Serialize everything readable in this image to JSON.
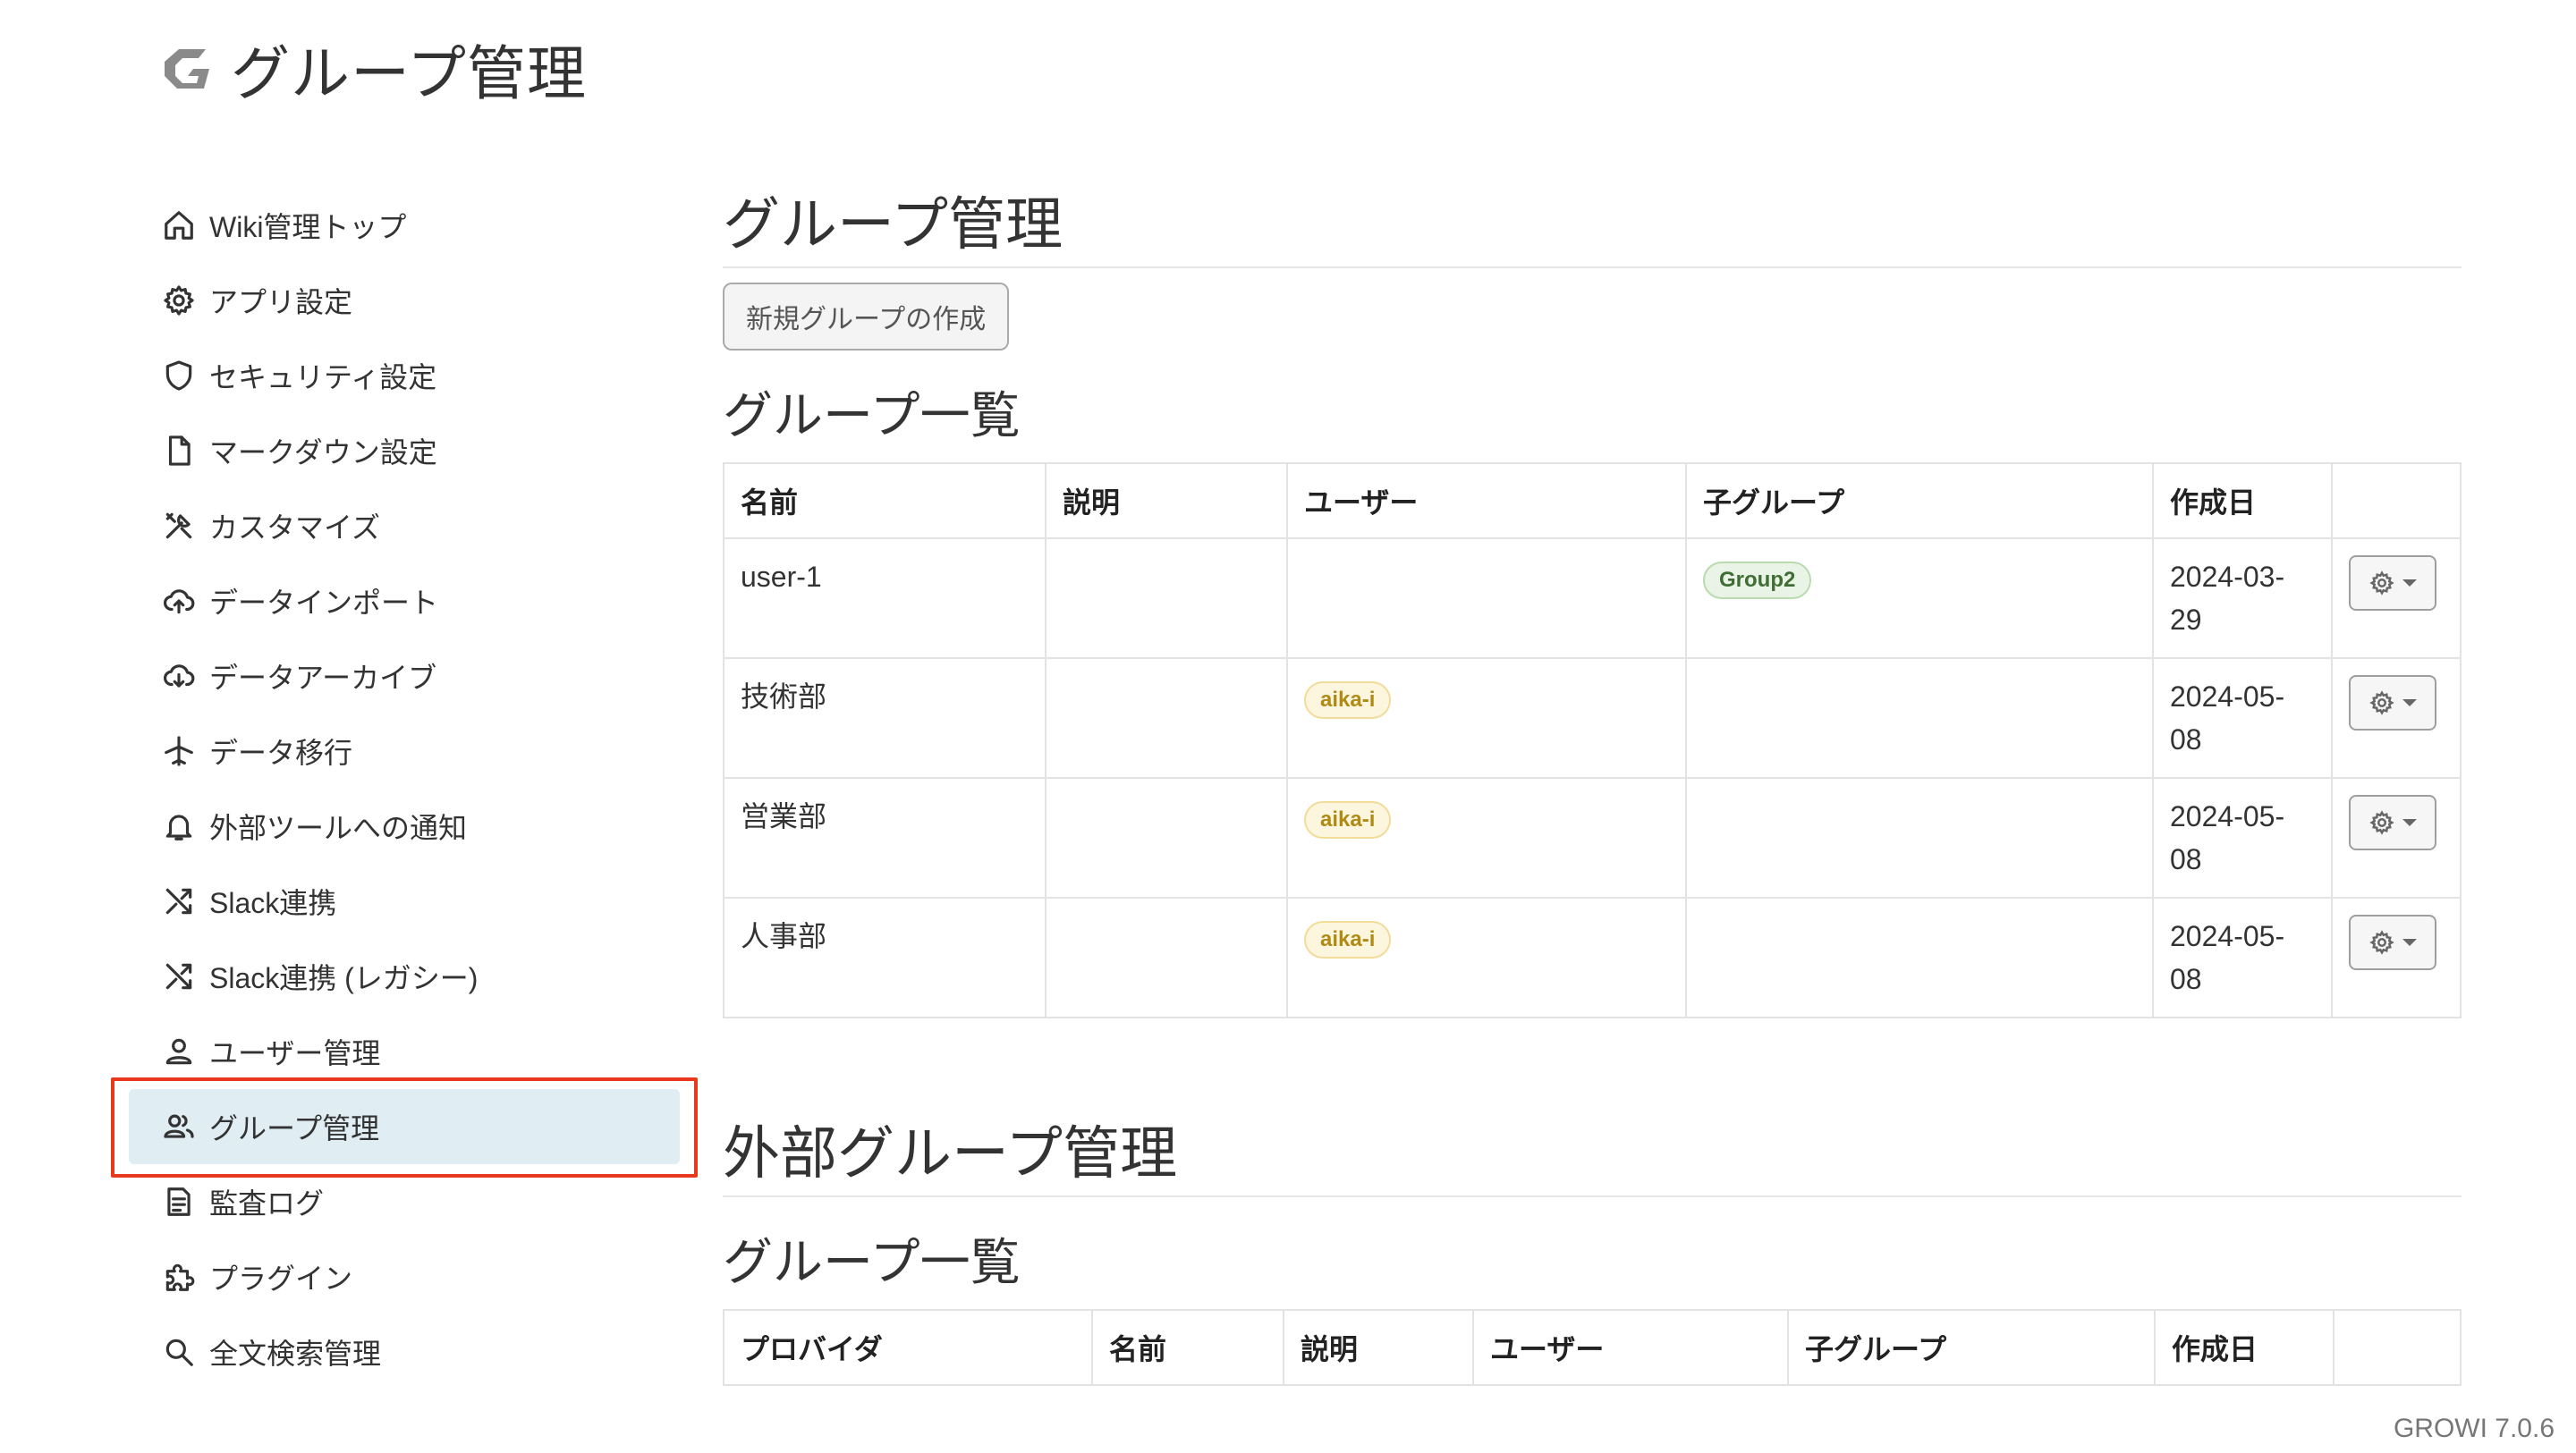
{
  "header": {
    "title": "グループ管理"
  },
  "sidebar": {
    "items": [
      {
        "label": "Wiki管理トップ",
        "icon": "home-icon"
      },
      {
        "label": "アプリ設定",
        "icon": "gear-icon"
      },
      {
        "label": "セキュリティ設定",
        "icon": "shield-icon"
      },
      {
        "label": "マークダウン設定",
        "icon": "file-icon"
      },
      {
        "label": "カスタマイズ",
        "icon": "tools-icon"
      },
      {
        "label": "データインポート",
        "icon": "cloud-upload-icon"
      },
      {
        "label": "データアーカイブ",
        "icon": "cloud-download-icon"
      },
      {
        "label": "データ移行",
        "icon": "airplane-icon"
      },
      {
        "label": "外部ツールへの通知",
        "icon": "bell-icon"
      },
      {
        "label": "Slack連携",
        "icon": "shuffle-icon"
      },
      {
        "label": "Slack連携 (レガシー)",
        "icon": "shuffle-icon"
      },
      {
        "label": "ユーザー管理",
        "icon": "person-icon"
      },
      {
        "label": "グループ管理",
        "icon": "people-icon",
        "active": true
      },
      {
        "label": "監査ログ",
        "icon": "document-icon"
      },
      {
        "label": "プラグイン",
        "icon": "puzzle-icon"
      },
      {
        "label": "全文検索管理",
        "icon": "search-icon"
      }
    ]
  },
  "main": {
    "title": "グループ管理",
    "create_button": "新規グループの作成",
    "list_title": "グループ一覧",
    "columns": [
      "名前",
      "説明",
      "ユーザー",
      "子グループ",
      "作成日",
      ""
    ],
    "rows": [
      {
        "name": "user-1",
        "description": "",
        "users": "",
        "child_group": "Group2",
        "created": "2024-03-29"
      },
      {
        "name": "技術部",
        "description": "",
        "users": "aika-i",
        "child_group": "",
        "created": "2024-05-08"
      },
      {
        "name": "営業部",
        "description": "",
        "users": "aika-i",
        "child_group": "",
        "created": "2024-05-08"
      },
      {
        "name": "人事部",
        "description": "",
        "users": "aika-i",
        "child_group": "",
        "created": "2024-05-08"
      }
    ]
  },
  "external": {
    "title": "外部グループ管理",
    "list_title": "グループ一覧",
    "columns": [
      "プロバイダ",
      "名前",
      "説明",
      "ユーザー",
      "子グループ",
      "作成日",
      ""
    ]
  },
  "footer": {
    "version": "GROWI 7.0.6"
  },
  "colors": {
    "active_bg": "#e0eef4",
    "highlight": "#e8391c"
  }
}
